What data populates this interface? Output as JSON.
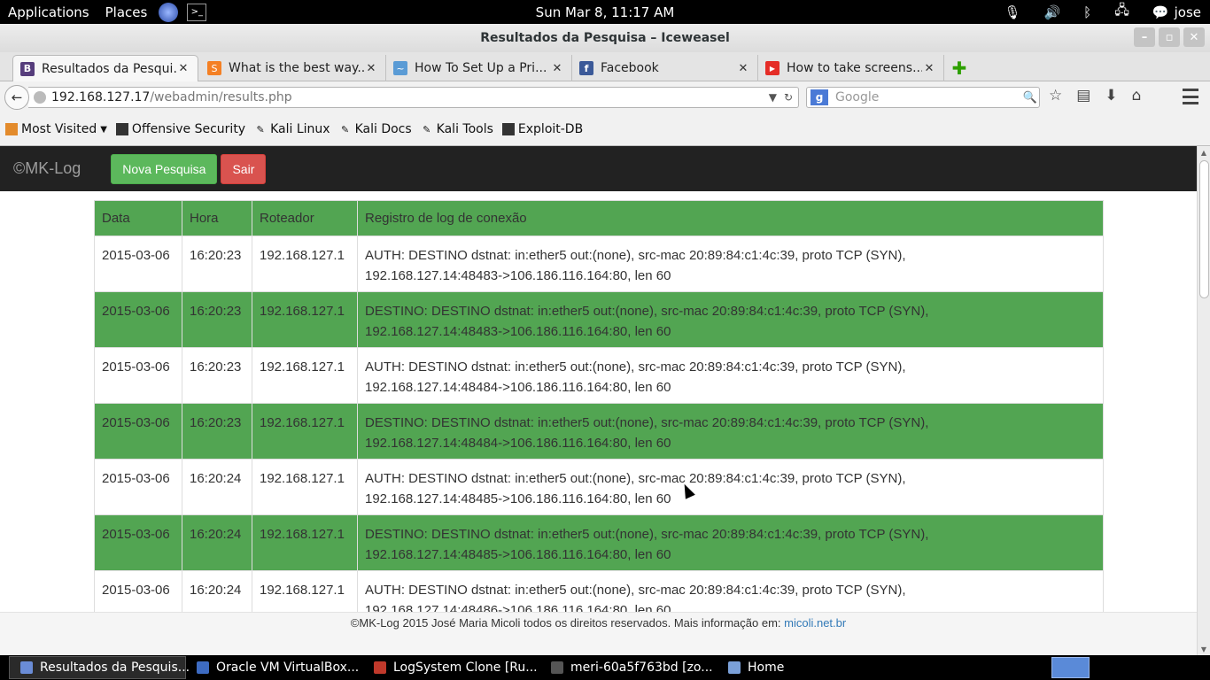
{
  "top_panel": {
    "applications": "Applications",
    "places": "Places",
    "clock": "Sun Mar  8, 11:17 AM",
    "user": "jose"
  },
  "window": {
    "title": "Resultados da Pesquisa – Iceweasel"
  },
  "tabs": [
    {
      "label": "Resultados da Pesqui...",
      "favicon": "B",
      "color": "#563d7c"
    },
    {
      "label": "What is the best way...",
      "favicon": "S",
      "color": "#f48024"
    },
    {
      "label": "How To Set Up a Pri...",
      "favicon": "~",
      "color": "#5a9bd5"
    },
    {
      "label": "Facebook",
      "favicon": "f",
      "color": "#3b5998"
    },
    {
      "label": "How to take screens...",
      "favicon": "▶",
      "color": "#e52d27"
    }
  ],
  "nav": {
    "url_host": "192.168.127.17",
    "url_path": "/webadmin/results.php",
    "search_placeholder": "Google"
  },
  "bookmarks": [
    {
      "label": "Most Visited"
    },
    {
      "label": "Offensive Security"
    },
    {
      "label": "Kali Linux"
    },
    {
      "label": "Kali Docs"
    },
    {
      "label": "Kali Tools"
    },
    {
      "label": "Exploit-DB"
    }
  ],
  "page": {
    "brand": "©MK-Log",
    "new_search_button": "Nova Pesquisa",
    "logout_button": "Sair",
    "table": {
      "headers": [
        "Data",
        "Hora",
        "Roteador",
        "Registro de log de conexão"
      ],
      "rows": [
        {
          "data": "2015-03-06",
          "hora": "16:20:23",
          "roteador": "192.168.127.1",
          "log1": "AUTH: DESTINO dstnat: in:ether5 out:(none), src-mac 20:89:84:c1:4c:39, proto TCP (SYN),",
          "log2": "192.168.127.14:48483->106.186.116.164:80, len 60"
        },
        {
          "data": "2015-03-06",
          "hora": "16:20:23",
          "roteador": "192.168.127.1",
          "log1": "DESTINO: DESTINO dstnat: in:ether5 out:(none), src-mac 20:89:84:c1:4c:39, proto TCP (SYN),",
          "log2": "192.168.127.14:48483->106.186.116.164:80, len 60"
        },
        {
          "data": "2015-03-06",
          "hora": "16:20:23",
          "roteador": "192.168.127.1",
          "log1": "AUTH: DESTINO dstnat: in:ether5 out:(none), src-mac 20:89:84:c1:4c:39, proto TCP (SYN),",
          "log2": "192.168.127.14:48484->106.186.116.164:80, len 60"
        },
        {
          "data": "2015-03-06",
          "hora": "16:20:23",
          "roteador": "192.168.127.1",
          "log1": "DESTINO: DESTINO dstnat: in:ether5 out:(none), src-mac 20:89:84:c1:4c:39, proto TCP (SYN),",
          "log2": "192.168.127.14:48484->106.186.116.164:80, len 60"
        },
        {
          "data": "2015-03-06",
          "hora": "16:20:24",
          "roteador": "192.168.127.1",
          "log1": "AUTH: DESTINO dstnat: in:ether5 out:(none), src-mac 20:89:84:c1:4c:39, proto TCP (SYN),",
          "log2": "192.168.127.14:48485->106.186.116.164:80, len 60"
        },
        {
          "data": "2015-03-06",
          "hora": "16:20:24",
          "roteador": "192.168.127.1",
          "log1": "DESTINO: DESTINO dstnat: in:ether5 out:(none), src-mac 20:89:84:c1:4c:39, proto TCP (SYN),",
          "log2": "192.168.127.14:48485->106.186.116.164:80, len 60"
        },
        {
          "data": "2015-03-06",
          "hora": "16:20:24",
          "roteador": "192.168.127.1",
          "log1": "AUTH: DESTINO dstnat: in:ether5 out:(none), src-mac 20:89:84:c1:4c:39, proto TCP (SYN),",
          "log2": "192.168.127.14:48486->106.186.116.164:80, len 60"
        }
      ]
    },
    "footer_text": "©MK-Log 2015 José Maria Micoli todos os direitos reservados. Mais informação em: ",
    "footer_link": "micoli.net.br"
  },
  "taskbar": [
    {
      "label": "Resultados da Pesquis..."
    },
    {
      "label": "Oracle VM VirtualBox..."
    },
    {
      "label": "LogSystem Clone [Ru..."
    },
    {
      "label": "meri-60a5f763bd [zo..."
    },
    {
      "label": "Home"
    }
  ],
  "colors": {
    "row_highlight": "#52a552",
    "navbar": "#222222",
    "btn_success": "#5cb85c",
    "btn_danger": "#d9534f"
  }
}
